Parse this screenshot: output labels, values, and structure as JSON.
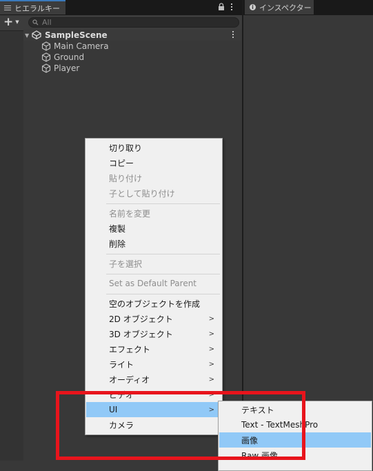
{
  "hierarchy": {
    "tab_label": "ヒエラルキー",
    "search_placeholder": "All",
    "scene": {
      "name": "SampleScene"
    },
    "objects": [
      {
        "name": "Main Camera"
      },
      {
        "name": "Ground"
      },
      {
        "name": "Player"
      }
    ]
  },
  "inspector": {
    "tab_label": "インスペクター"
  },
  "context_menu": {
    "items": [
      {
        "label": "切り取り"
      },
      {
        "label": "コピー"
      },
      {
        "label": "貼り付け"
      },
      {
        "label": "子として貼り付け"
      },
      {
        "label": "名前を変更"
      },
      {
        "label": "複製"
      },
      {
        "label": "削除"
      },
      {
        "label": "子を選択"
      },
      {
        "label": "Set as Default Parent"
      },
      {
        "label": "空のオブジェクトを作成"
      },
      {
        "label": "2D オブジェクト"
      },
      {
        "label": "3D オブジェクト"
      },
      {
        "label": "エフェクト"
      },
      {
        "label": "ライト"
      },
      {
        "label": "オーディオ"
      },
      {
        "label": "ビデオ"
      },
      {
        "label": "UI"
      },
      {
        "label": "カメラ"
      }
    ]
  },
  "ui_submenu": {
    "items": [
      {
        "label": "テキスト"
      },
      {
        "label": "Text - TextMeshPro"
      },
      {
        "label": "画像"
      },
      {
        "label": "Raw 画像"
      }
    ]
  },
  "colors": {
    "highlight": "#91c9f7",
    "annotation": "#e8141c",
    "tab_accent": "#3a79bb"
  }
}
